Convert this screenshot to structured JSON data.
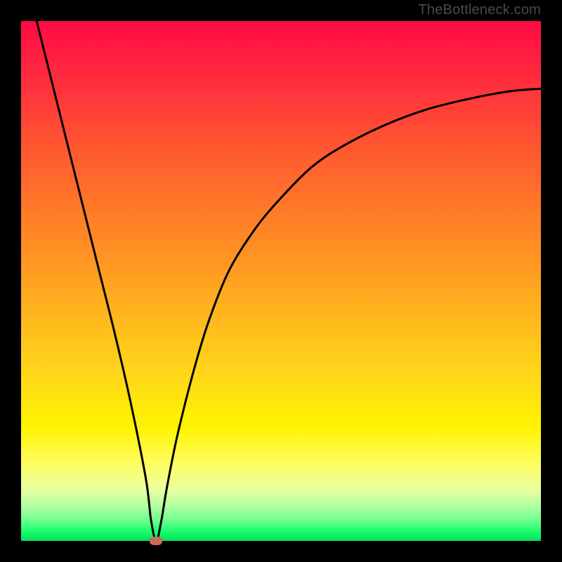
{
  "watermark": "TheBottleneck.com",
  "chart_data": {
    "type": "line",
    "title": "",
    "xlabel": "",
    "ylabel": "",
    "xlim": [
      0,
      100
    ],
    "ylim": [
      0,
      100
    ],
    "grid": false,
    "legend": false,
    "series": [
      {
        "name": "curve",
        "x": [
          3,
          6,
          9,
          12,
          15,
          18,
          21,
          24,
          25,
          26,
          27,
          28,
          30,
          33,
          36,
          40,
          45,
          50,
          56,
          62,
          70,
          78,
          86,
          94,
          100
        ],
        "y": [
          100,
          88,
          76,
          64,
          52,
          40,
          27,
          12,
          4,
          0,
          4,
          10,
          20,
          32,
          42,
          52,
          60,
          66,
          72,
          76,
          80,
          83,
          85,
          86.5,
          87
        ]
      }
    ],
    "marker": {
      "x": 26,
      "y": 0,
      "color": "#c86a5c"
    },
    "gradient_stops": [
      {
        "pct": 0,
        "color": "#ff0a44"
      },
      {
        "pct": 12,
        "color": "#ff2f3d"
      },
      {
        "pct": 25,
        "color": "#ff5930"
      },
      {
        "pct": 40,
        "color": "#ff8426"
      },
      {
        "pct": 55,
        "color": "#ffb11e"
      },
      {
        "pct": 68,
        "color": "#ffd81a"
      },
      {
        "pct": 78,
        "color": "#fff300"
      },
      {
        "pct": 85,
        "color": "#fffe5e"
      },
      {
        "pct": 90,
        "color": "#eaffa0"
      },
      {
        "pct": 93,
        "color": "#b7ffa5"
      },
      {
        "pct": 96,
        "color": "#70ff8e"
      },
      {
        "pct": 98,
        "color": "#1fff6f"
      },
      {
        "pct": 100,
        "color": "#00e060"
      }
    ]
  }
}
